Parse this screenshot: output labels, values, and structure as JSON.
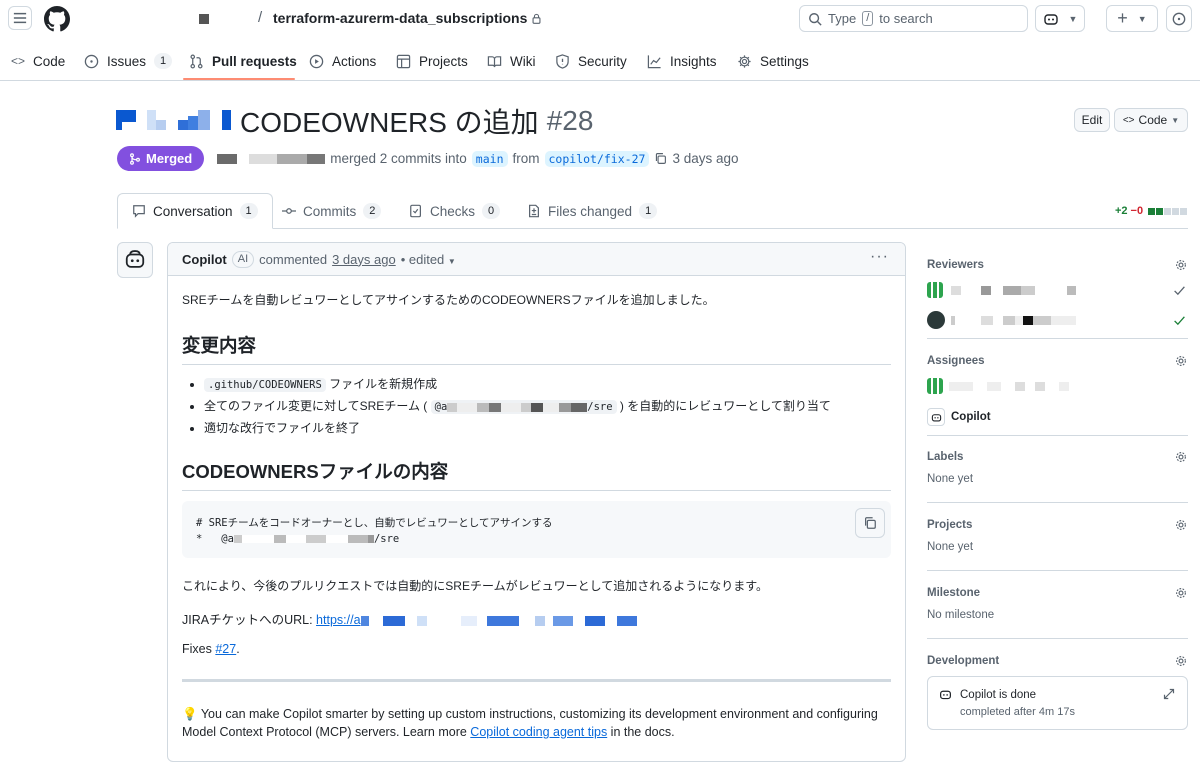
{
  "header": {
    "repo_name": "terraform-azurerm-data_subscriptions",
    "search_placeholder_pre": "Type",
    "search_key": "/",
    "search_placeholder_post": "to search"
  },
  "nav": {
    "code": "Code",
    "issues": "Issues",
    "issues_count": "1",
    "pulls": "Pull requests",
    "actions": "Actions",
    "projects": "Projects",
    "wiki": "Wiki",
    "security": "Security",
    "insights": "Insights",
    "settings": "Settings"
  },
  "pr": {
    "title": "CODEOWNERS の追加",
    "number": "#28",
    "edit_label": "Edit",
    "code_label": "Code",
    "state": "Merged",
    "merged_text": "merged 2 commits into",
    "base_branch": "main",
    "from_text": "from",
    "head_branch": "copilot/fix-27",
    "when": "3 days ago"
  },
  "tabs": {
    "conversation": "Conversation",
    "conversation_count": "1",
    "commits": "Commits",
    "commits_count": "2",
    "checks": "Checks",
    "checks_count": "0",
    "files": "Files changed",
    "files_count": "1",
    "additions": "+2",
    "deletions": "−0"
  },
  "comment": {
    "author": "Copilot",
    "badge": "AI",
    "action": "commented",
    "when": "3 days ago",
    "edited": "• edited",
    "intro": "SREチームを自動レビュワーとしてアサインするためのCODEOWNERSファイルを追加しました。",
    "h_changes": "変更内容",
    "li1_code": ".github/CODEOWNERS",
    "li1_text": " ファイルを新規作成",
    "li2_pre": "全てのファイル変更に対してSREチーム ( ",
    "li2_code_start": "@a",
    "li2_code_end": "/sre",
    "li2_post": " ) を自動的にレビュワーとして割り当て",
    "li3": "適切な改行でファイルを終了",
    "h_file": "CODEOWNERSファイルの内容",
    "code_line1": "# SREチームをコードオーナーとし、自動でレビュワーとしてアサインする",
    "code_line2_start": "*   @a",
    "code_line2_end": "/sre",
    "result": "これにより、今後のプルリクエストでは自動的にSREチームがレビュワーとして追加されるようになります。",
    "jira_label": "JIRAチケットへのURL: ",
    "jira_link_start": "https://a",
    "fixes_text": "Fixes ",
    "fixes_link": "#27",
    "fixes_end": ".",
    "tip_pre": "You can make Copilot smarter by setting up custom instructions, customizing its development environment and configuring Model Context Protocol (MCP) servers. Learn more ",
    "tip_link": "Copilot coding agent tips",
    "tip_post": " in the docs."
  },
  "sidebar": {
    "reviewers": "Reviewers",
    "assignees": "Assignees",
    "assignee_copilot": "Copilot",
    "labels": "Labels",
    "labels_value": "None yet",
    "projects": "Projects",
    "projects_value": "None yet",
    "milestone": "Milestone",
    "milestone_value": "No milestone",
    "development": "Development",
    "dev_status": "Copilot is done",
    "dev_sub": "completed after 4m 17s"
  },
  "colors": {
    "merged": "#8250df",
    "link": "#0969da",
    "success": "#1a7f37",
    "danger": "#d1242f",
    "underline": "#fd8c73"
  }
}
